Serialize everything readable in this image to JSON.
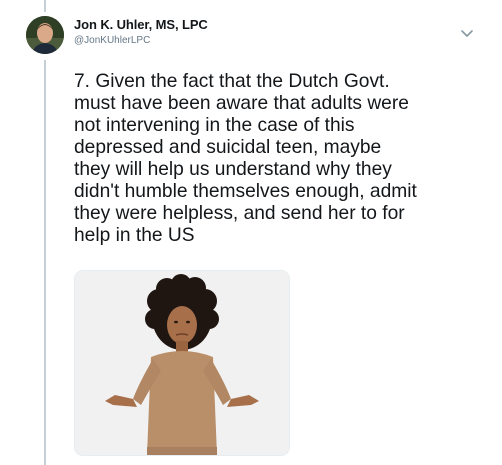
{
  "tweet": {
    "author": {
      "display_name": "Jon K. Uhler, MS, LPC",
      "handle": "@JonKUhlerLPC"
    },
    "text": "7. Given the fact that the Dutch Govt.\nmust have been aware that adults were\nnot intervening in the case of this\ndepressed and suicidal teen, maybe\nthey will help us understand why they\ndidn't humble themselves enough, admit\nthey were helpless, and send her to for\nhelp in the US",
    "media": {
      "kind": "photo"
    }
  },
  "icons": {
    "caret": "chevron-down-icon"
  },
  "colors": {
    "text": "#14171a",
    "secondary_text": "#657786",
    "thread_line": "#c4cfd6",
    "media_background": "#f2f2f2",
    "sweater": "#b98f6a"
  }
}
